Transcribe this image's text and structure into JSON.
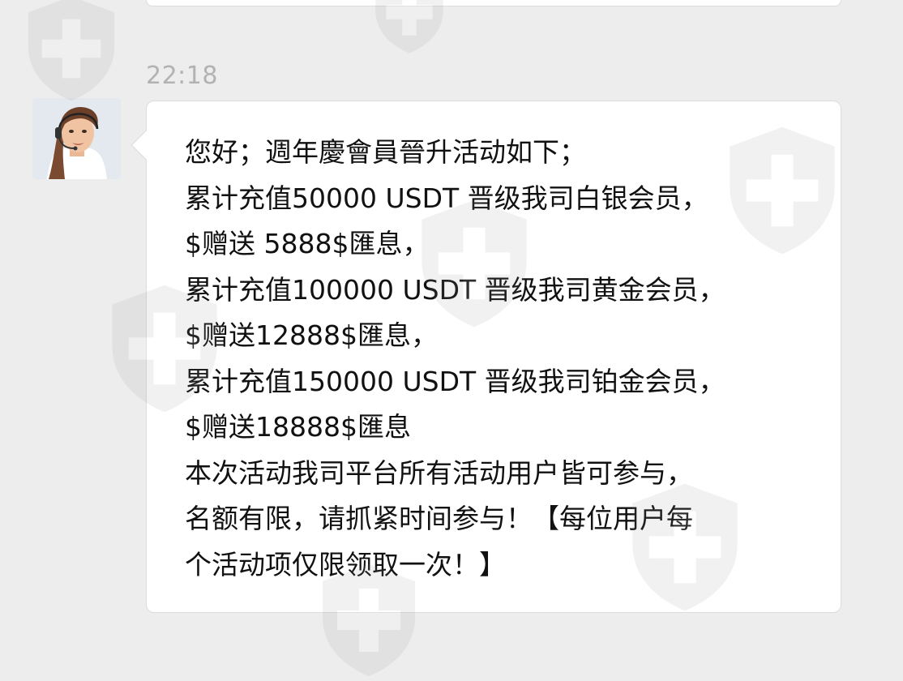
{
  "chat": {
    "timestamp": "22:18",
    "message": {
      "sender_avatar": "customer-service-agent-with-headset",
      "lines": [
        "您好；週年慶會員晉升活动如下；",
        "累计充值50000 USDT 晋级我司白银会员，",
        "$赠送 5888$匯息，",
        "累计充值100000 USDT 晋级我司黄金会员，",
        "$赠送12888$匯息，",
        "累计充值150000 USDT 晋级我司铂金会员，",
        "$赠送18888$匯息",
        "本次活动我司平台所有活动用户皆可参与，",
        "名额有限，请抓紧时间参与！【每位用户每",
        "个活动项仅限领取一次！】"
      ]
    }
  },
  "watermark": {
    "icon": "shield-plus-icon",
    "color": "#8f8f8f"
  },
  "colors": {
    "background": "#ededed",
    "bubble": "#ffffff",
    "bubble_border": "#dcdcdc",
    "text": "#111111",
    "timestamp": "#b2b2b2"
  }
}
